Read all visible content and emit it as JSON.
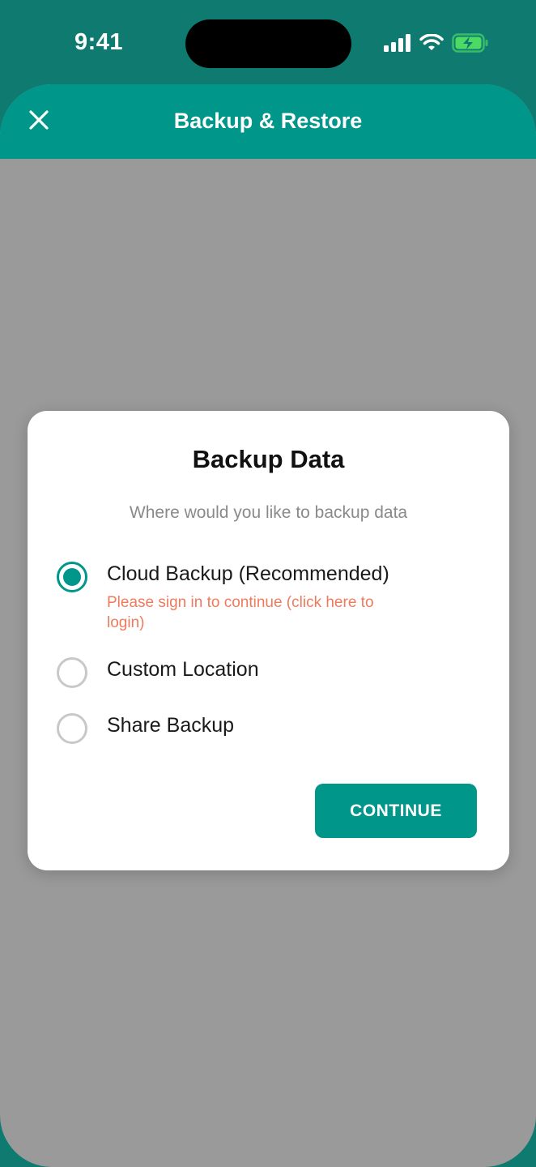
{
  "status_bar": {
    "time": "9:41",
    "icons": [
      "cellular-signal-icon",
      "wifi-icon",
      "battery-charging-icon"
    ]
  },
  "header": {
    "title": "Backup & Restore",
    "close_icon": "close-icon"
  },
  "dialog": {
    "title": "Backup Data",
    "subtitle": "Where would you like to backup data",
    "options": [
      {
        "label": "Cloud Backup (Recommended)",
        "note": "Please sign in to continue (click here to login)",
        "selected": true
      },
      {
        "label": "Custom Location",
        "selected": false
      },
      {
        "label": "Share Backup",
        "selected": false
      }
    ],
    "continue_label": "CONTINUE"
  },
  "colors": {
    "accent": "#00968a",
    "status_bar_bg": "#0f7a70",
    "overlay": "#9a9a9a",
    "warning_text": "#f07a5c",
    "battery": "#4cd964"
  }
}
